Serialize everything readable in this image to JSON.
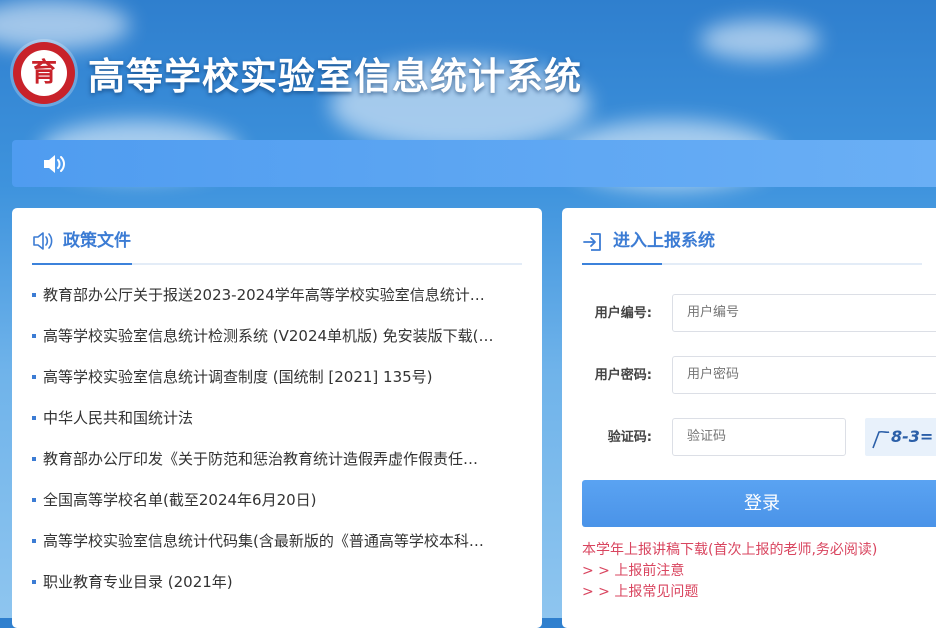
{
  "header": {
    "logo_glyph": "育",
    "site_title": "高等学校实验室信息统计系统"
  },
  "notice_bar": {
    "icon": "speaker-icon"
  },
  "policy_panel": {
    "title": "政策文件",
    "icon": "speaker-outline-icon",
    "items": [
      " 教育部办公厅关于报送2023-2024学年高等学校实验室信息统计…",
      "高等学校实验室信息统计检测系统 (V2024单机版) 免安装版下载(…",
      "高等学校实验室信息统计调查制度 (国统制 [2021] 135号)",
      "中华人民共和国统计法",
      "教育部办公厅印发《关于防范和惩治教育统计造假弄虚作假责任…",
      "全国高等学校名单(截至2024年6月20日)",
      "高等学校实验室信息统计代码集(含最新版的《普通高等学校本科…",
      "职业教育专业目录 (2021年)"
    ]
  },
  "login_panel": {
    "title": "进入上报系统",
    "icon": "login-icon",
    "user_label": "用户编号:",
    "user_placeholder": "用户编号",
    "password_label": "用户密码:",
    "password_placeholder": "用户密码",
    "captcha_label": "验证码:",
    "captcha_placeholder": "验证码",
    "captcha_text": "8-3=",
    "login_button": "登录",
    "links": [
      "本学年上报讲稿下载(首次上报的老师,务必阅读)",
      "> > 上报前注意",
      "> > 上报常见问题"
    ]
  },
  "colors": {
    "accent": "#3c7cd4",
    "link_red": "#d9455f",
    "logo_red": "#c8222a"
  }
}
